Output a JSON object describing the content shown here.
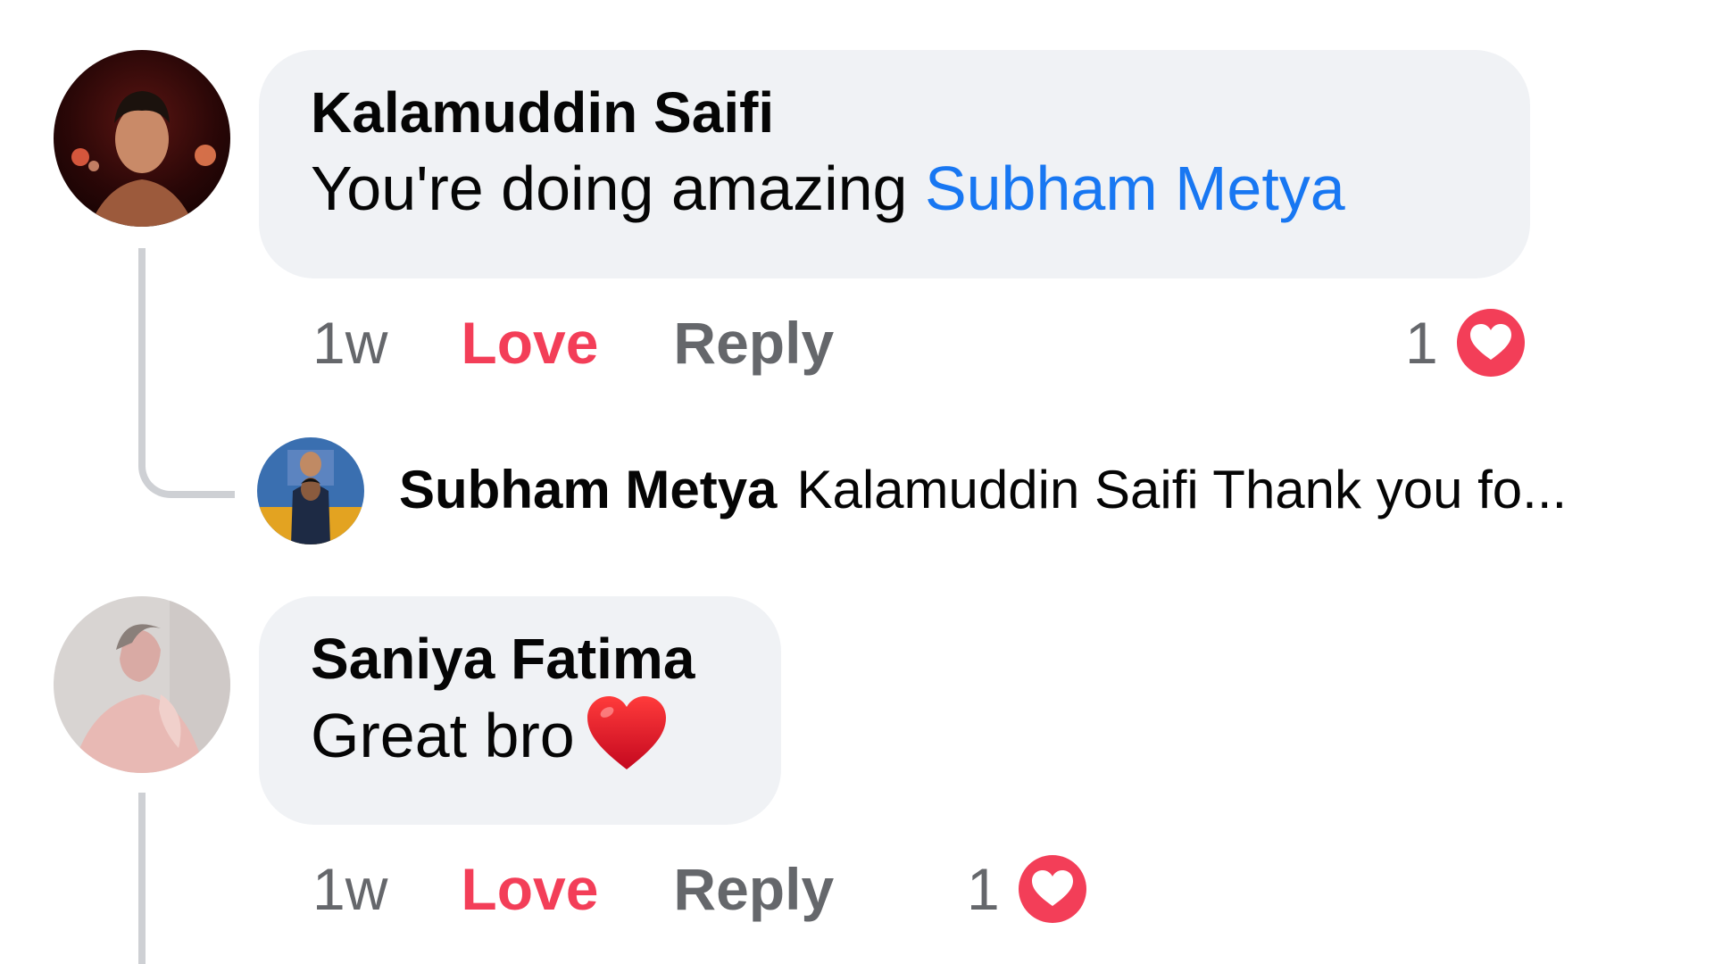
{
  "comments": [
    {
      "author": "Kalamuddin Saifi",
      "text": "You're doing amazing ",
      "mention": "Subham Metya",
      "time": "1w",
      "love_label": "Love",
      "reply_label": "Reply",
      "reaction_count": "1",
      "reaction_icon": "love-reaction-icon",
      "reply": {
        "author": "Subham Metya",
        "text": "Kalamuddin Saifi Thank you fo..."
      }
    },
    {
      "author": "Saniya Fatima",
      "text": "Great bro",
      "emoji": "red-heart-emoji",
      "time": "1w",
      "love_label": "Love",
      "reply_label": "Reply",
      "reaction_count": "1",
      "reaction_icon": "love-reaction-icon"
    }
  ],
  "colors": {
    "bubble": "#f0f2f5",
    "mention": "#1877f2",
    "love": "#f33e58",
    "muted": "#65676b",
    "thread_line": "#ced0d4"
  }
}
